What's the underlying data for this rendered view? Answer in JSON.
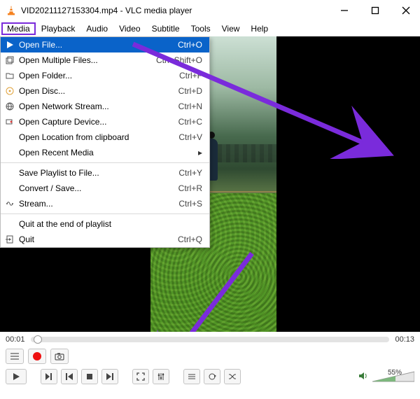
{
  "title": "VID20211127153304.mp4 - VLC media player",
  "menubar": [
    "Media",
    "Playback",
    "Audio",
    "Video",
    "Subtitle",
    "Tools",
    "View",
    "Help"
  ],
  "menubar_active_index": 0,
  "dropdown": [
    {
      "icon": "play",
      "label": "Open File...",
      "short": "Ctrl+O",
      "hover": true
    },
    {
      "icon": "multi",
      "label": "Open Multiple Files...",
      "short": "Ctrl+Shift+O"
    },
    {
      "icon": "folder",
      "label": "Open Folder...",
      "short": "Ctrl+F"
    },
    {
      "icon": "disc",
      "label": "Open Disc...",
      "short": "Ctrl+D"
    },
    {
      "icon": "net",
      "label": "Open Network Stream...",
      "short": "Ctrl+N"
    },
    {
      "icon": "cap",
      "label": "Open Capture Device...",
      "short": "Ctrl+C"
    },
    {
      "icon": "",
      "label": "Open Location from clipboard",
      "short": "Ctrl+V"
    },
    {
      "icon": "",
      "label": "Open Recent Media",
      "short": "",
      "submenu": true
    },
    {
      "sep": true
    },
    {
      "icon": "",
      "label": "Save Playlist to File...",
      "short": "Ctrl+Y"
    },
    {
      "icon": "",
      "label": "Convert / Save...",
      "short": "Ctrl+R"
    },
    {
      "icon": "wave",
      "label": "Stream...",
      "short": "Ctrl+S"
    },
    {
      "sep": true
    },
    {
      "icon": "",
      "label": "Quit at the end of playlist",
      "short": ""
    },
    {
      "icon": "quit",
      "label": "Quit",
      "short": "Ctrl+Q"
    }
  ],
  "time_elapsed": "00:01",
  "time_total": "00:13",
  "volume_pct": "55%",
  "controls": {
    "play": "▶",
    "step": "▶|",
    "prev": "⏮",
    "stop": "■",
    "next": "⏭",
    "full": "⛶",
    "eq": "⚙",
    "list": "≡",
    "loop": "↻",
    "shuffle": "✕"
  }
}
